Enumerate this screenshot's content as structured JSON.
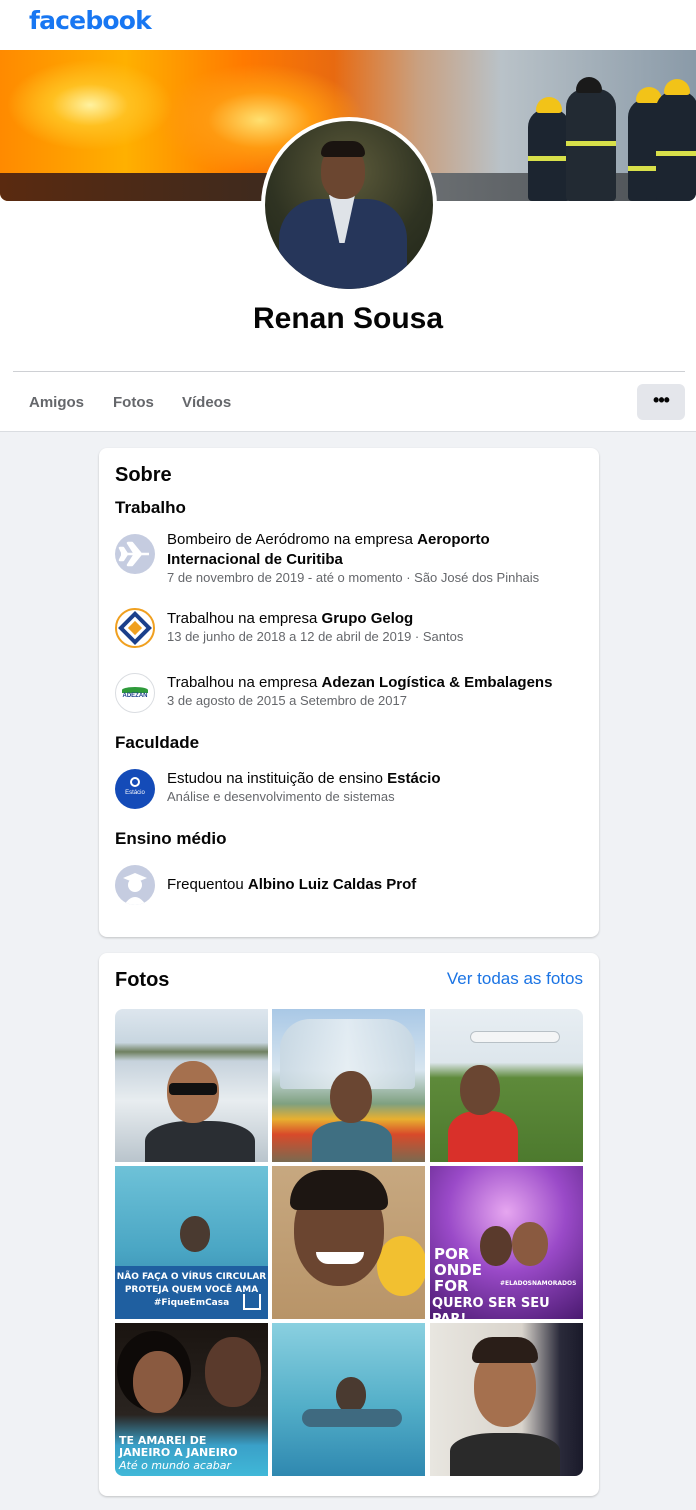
{
  "app": {
    "logo": "facebook"
  },
  "profile": {
    "name": "Renan Sousa",
    "tabs": [
      "Amigos",
      "Fotos",
      "Vídeos"
    ],
    "more_label": "•••"
  },
  "about": {
    "title": "Sobre",
    "work_title": "Trabalho",
    "work": [
      {
        "prefix": "Bombeiro de Aeródromo na empresa ",
        "company": "Aeroporto Internacional de Curitiba",
        "detail": "7 de novembro de 2019 - até o momento · São José dos Pinhais",
        "icon": "airplane-icon"
      },
      {
        "prefix": "Trabalhou na empresa ",
        "company": "Grupo Gelog",
        "detail": "13 de junho de 2018 a 12 de abril de 2019 · Santos",
        "icon": "gelog-logo-icon"
      },
      {
        "prefix": "Trabalhou na empresa ",
        "company": "Adezan Logística & Embalagens",
        "detail": "3 de agosto de 2015 a Setembro de 2017",
        "icon": "adezan-logo-icon",
        "logo_text": "ADEZAN"
      }
    ],
    "college_title": "Faculdade",
    "college": {
      "prefix": "Estudou na instituição de ensino ",
      "school": "Estácio",
      "detail": "Análise e desenvolvimento de sistemas",
      "icon": "estacio-logo-icon",
      "logo_text": "Estácio"
    },
    "highschool_title": "Ensino médio",
    "highschool": {
      "prefix": "Frequentou ",
      "school": "Albino Luiz Caldas Prof",
      "icon": "graduation-cap-icon"
    }
  },
  "photos": {
    "title": "Fotos",
    "see_all": "Ver todas as fotos",
    "captions": {
      "p4_line1": "NÃO FAÇA O VÍRUS CIRCULAR",
      "p4_line2": "PROTEJA QUEM VOCÊ AMA",
      "p4_line3": "#FiqueEmCasa",
      "p6_line1": "POR",
      "p6_line2": "ONDE",
      "p6_line3": "FOR",
      "p6_line4": "QUERO SER SEU PAR!",
      "p6_tag": "#ELADOSNAMORADOS",
      "p7_line1": "TE AMAREI DE",
      "p7_line2": "JANEIRO A JANEIRO",
      "p7_line3": "Até o mundo acabar"
    }
  },
  "colors": {
    "brand": "#1877f2",
    "link": "#1b74e4",
    "page_bg": "#f0f2f5",
    "secondary_text": "#65676b"
  }
}
